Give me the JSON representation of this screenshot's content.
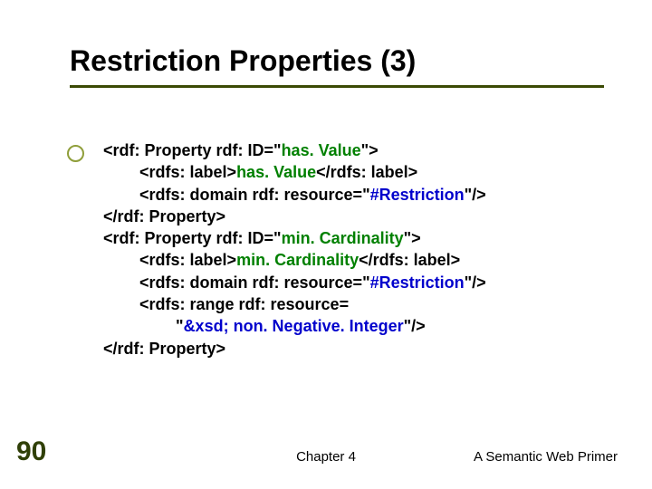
{
  "slide": {
    "title": "Restriction Properties (3)",
    "code": {
      "l1a": "<rdf: Property rdf: ID=\"",
      "l1b": "has. Value",
      "l1c": "\">",
      "l2a": "        <rdfs: label>",
      "l2b": "has. Value",
      "l2c": "</rdfs: label>",
      "l3a": "        <rdfs: domain rdf: resource=\"",
      "l3b": "#Restriction",
      "l3c": "\"/>",
      "l4": "</rdf: Property>",
      "l5a": "<rdf: Property rdf: ID=\"",
      "l5b": "min. Cardinality",
      "l5c": "\">",
      "l6a": "        <rdfs: label>",
      "l6b": "min. Cardinality",
      "l6c": "</rdfs: label>",
      "l7a": "        <rdfs: domain rdf: resource=\"",
      "l7b": "#Restriction",
      "l7c": "\"/>",
      "l8": "        <rdfs: range rdf: resource=",
      "l9a": "                \"",
      "l9b": "&xsd; non. Negative. Integer",
      "l9c": "\"/>",
      "l10": "</rdf: Property>"
    },
    "footer": {
      "page_number": "90",
      "chapter": "Chapter 4",
      "book": "A Semantic Web Primer"
    }
  }
}
